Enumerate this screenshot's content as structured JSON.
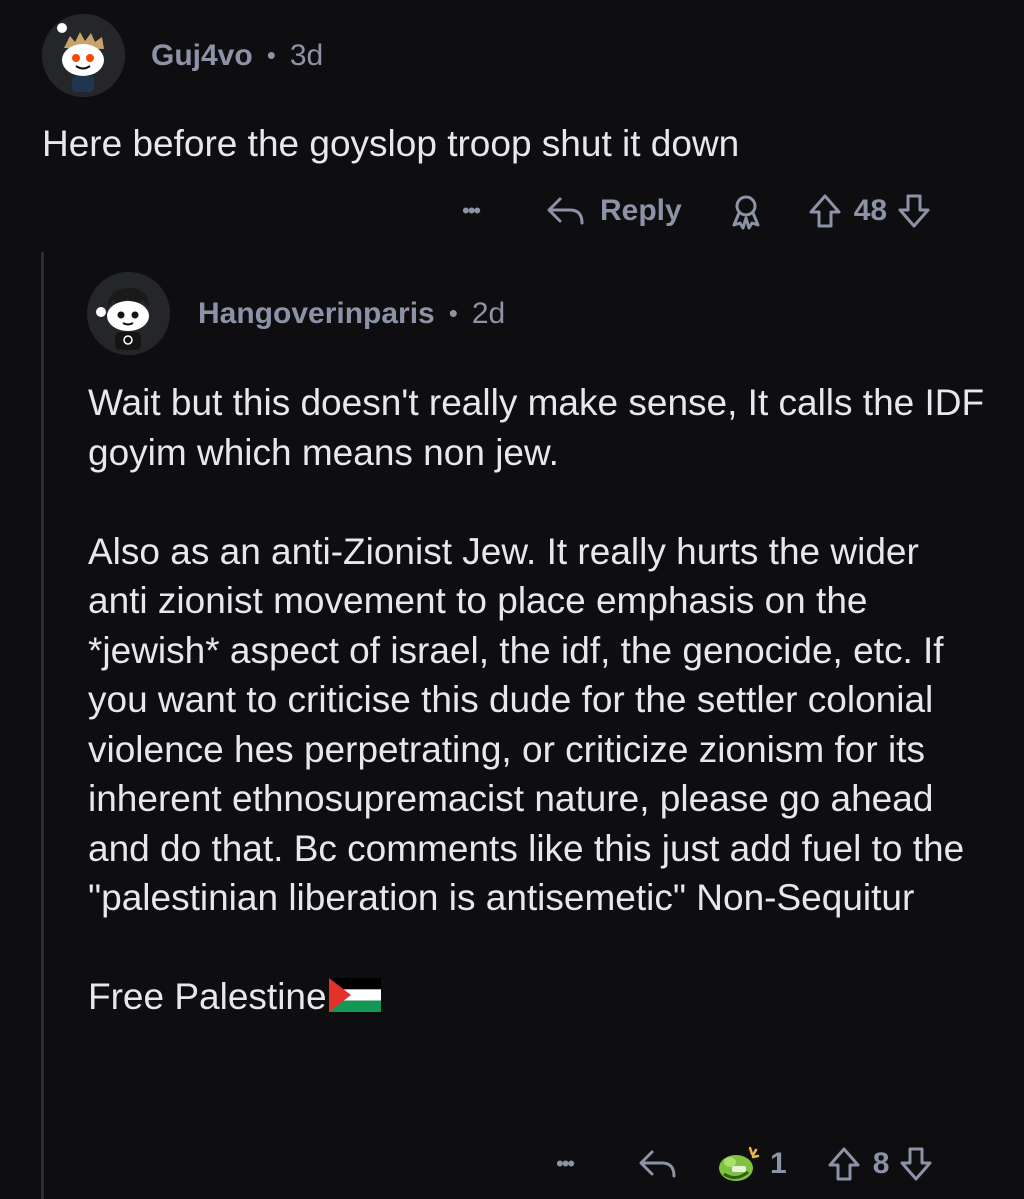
{
  "comments": [
    {
      "author": "Guj4vo",
      "separator": "•",
      "age": "3d",
      "body": [
        "Here before the goyslop troop shut it down"
      ],
      "actions": {
        "more": "•••",
        "reply_label": "Reply",
        "score": "48"
      }
    },
    {
      "author": "Hangoverinparis",
      "separator": "•",
      "age": "2d",
      "body": [
        "Wait but this doesn't really make sense, It calls the IDF goyim which means non jew.",
        "Also as an anti-Zionist Jew. It really hurts the wider anti zionist movement to place emphasis on the *jewish* aspect of israel, the idf, the genocide, etc. If you want to criticise this dude for the settler colonial violence hes perpetrating, or criticize zionism for its inherent ethnosupremacist nature, please go ahead and do that. Bc comments like this just add fuel to the \"palestinian liberation is antisemetic\" Non-Sequitur",
        "Free Palestine"
      ],
      "flag_emoji": "palestine-flag",
      "actions": {
        "more": "•••",
        "award_count": "1",
        "score": "8"
      }
    }
  ],
  "colors": {
    "background": "#0e0e10",
    "meta_text": "#8c93a6",
    "body_text": "#e6e8ea",
    "thread_line": "#2b2d31",
    "award_green": "#7fc241"
  },
  "icons": {
    "more": "ellipsis-icon",
    "reply": "reply-arrow-icon",
    "award": "award-icon",
    "upvote": "upvote-arrow-icon",
    "downvote": "downvote-arrow-icon"
  }
}
